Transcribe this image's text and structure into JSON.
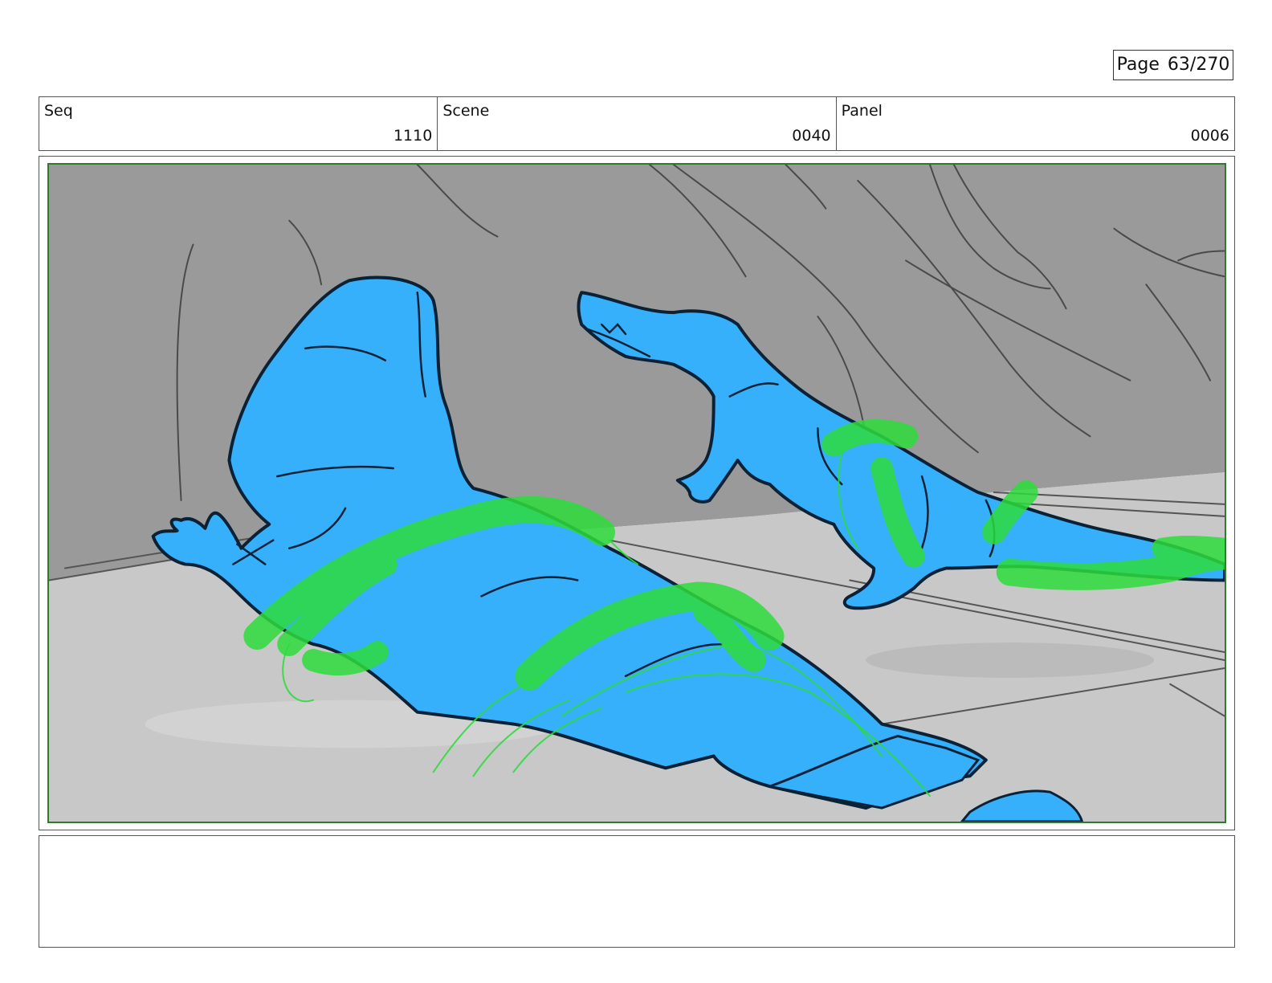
{
  "page_counter": {
    "label": "Page",
    "value": "63/270"
  },
  "header": {
    "seq": {
      "label": "Seq",
      "value": "1110"
    },
    "scene": {
      "label": "Scene",
      "value": "0040"
    },
    "panel": {
      "label": "Panel",
      "value": "0006"
    }
  },
  "colors": {
    "wall": "#9a9a9a",
    "floor": "#c8c8c8",
    "character_fill": "#36b0fb",
    "character_line": "#0b2236",
    "highlight": "#2edc3c",
    "frame_border": "#2f7a2f"
  },
  "notes": {
    "text": ""
  }
}
